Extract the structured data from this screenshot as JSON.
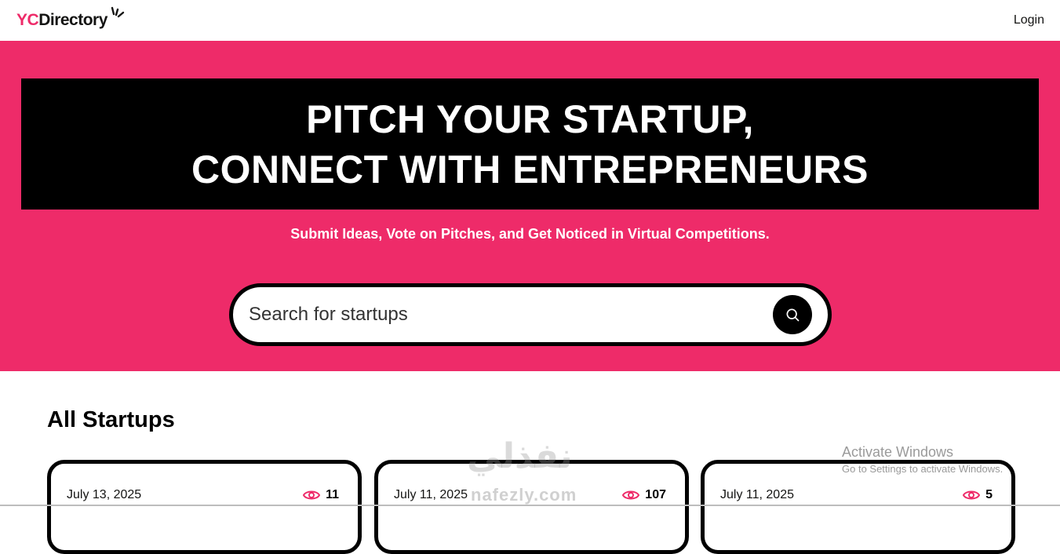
{
  "nav": {
    "logo_prefix": "YC",
    "logo_text": "Directory",
    "login_label": "Login"
  },
  "hero": {
    "line1": "PITCH YOUR STARTUP,",
    "line2": "CONNECT WITH ENTREPRENEURS",
    "subtitle": "Submit Ideas, Vote on Pitches, and Get Noticed in Virtual Competitions.",
    "search_placeholder": "Search for startups"
  },
  "startups": {
    "title": "All Startups",
    "cards": [
      {
        "date": "July 13, 2025",
        "views": "11"
      },
      {
        "date": "July 11, 2025",
        "views": "107"
      },
      {
        "date": "July 11, 2025",
        "views": "5"
      }
    ]
  },
  "overlay": {
    "watermark_ar": "نفذلي",
    "watermark_en": "nafezly.com",
    "activate_title": "Activate Windows",
    "activate_sub": "Go to Settings to activate Windows."
  },
  "colors": {
    "primary": "#ee2b69",
    "dark": "#000000",
    "white": "#ffffff"
  }
}
